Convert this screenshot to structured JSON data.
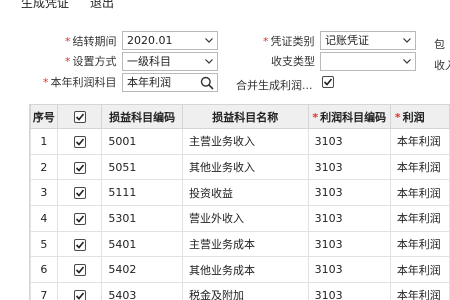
{
  "toolbar": {
    "generate_label": "生成凭证",
    "exit_label": "退出"
  },
  "form": {
    "period_label": "结转期间",
    "period_value": "2020.01",
    "voucher_type_label": "凭证类别",
    "voucher_type_value": "记账凭证",
    "cut_text_1": "包",
    "setup_method_label": "设置方式",
    "setup_method_value": "一级科目",
    "income_type_label": "收支类型",
    "income_type_value": "",
    "cut_text_2": "收入",
    "profit_subject_label": "本年利润科目",
    "profit_subject_value": "本年利润",
    "merge_label": "合并生成利润...",
    "merge_checked": true
  },
  "table": {
    "columns": [
      {
        "label": "序号",
        "required": false
      },
      {
        "label": "",
        "required": false
      },
      {
        "label": "损益科目编码",
        "required": false
      },
      {
        "label": "损益科目名称",
        "required": false
      },
      {
        "label": "利润科目编码",
        "required": true
      },
      {
        "label": "利润",
        "required": true
      }
    ],
    "rows": [
      {
        "seq": "1",
        "checked": true,
        "code": "5001",
        "name": "主营业务收入",
        "profit_code": "3103",
        "profit_name": "本年利润"
      },
      {
        "seq": "2",
        "checked": true,
        "code": "5051",
        "name": "其他业务收入",
        "profit_code": "3103",
        "profit_name": "本年利润"
      },
      {
        "seq": "3",
        "checked": true,
        "code": "5111",
        "name": "投资收益",
        "profit_code": "3103",
        "profit_name": "本年利润"
      },
      {
        "seq": "4",
        "checked": true,
        "code": "5301",
        "name": "营业外收入",
        "profit_code": "3103",
        "profit_name": "本年利润"
      },
      {
        "seq": "5",
        "checked": true,
        "code": "5401",
        "name": "主营业务成本",
        "profit_code": "3103",
        "profit_name": "本年利润"
      },
      {
        "seq": "6",
        "checked": true,
        "code": "5402",
        "name": "其他业务成本",
        "profit_code": "3103",
        "profit_name": "本年利润"
      },
      {
        "seq": "7",
        "checked": true,
        "code": "5403",
        "name": "税金及附加",
        "profit_code": "3103",
        "profit_name": "本年利润"
      }
    ]
  }
}
